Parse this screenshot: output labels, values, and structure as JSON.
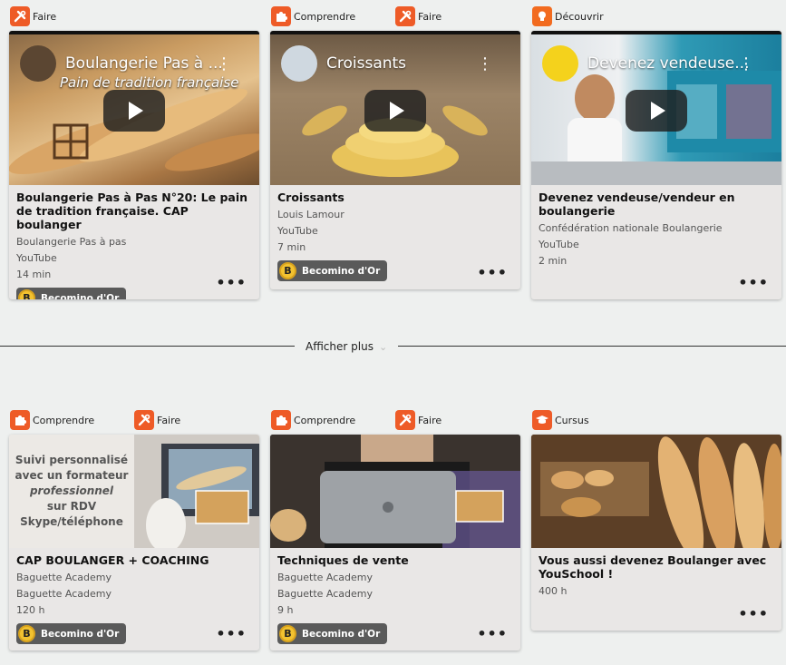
{
  "tag_labels": {
    "faire": "Faire",
    "comprendre": "Comprendre",
    "decouvrir": "Découvrir",
    "cursus": "Cursus"
  },
  "badge_label": "Becomino d'Or",
  "show_more": "Afficher plus",
  "cards": [
    {
      "overlay_title": "Boulangerie Pas à ...",
      "overlay_subtitle": "Pain de tradition française",
      "title": "Boulangerie Pas à Pas N°20: Le pain de tradition française. CAP boulanger",
      "meta": [
        "Boulangerie Pas à pas",
        "YouTube",
        "14 min"
      ]
    },
    {
      "overlay_title": "Croissants",
      "title": "Croissants",
      "meta": [
        "Louis Lamour",
        "YouTube",
        "7 min"
      ]
    },
    {
      "overlay_title": "Devenez vendeuse...",
      "title": "Devenez vendeuse/vendeur en boulangerie",
      "meta": [
        "Confédération nationale Boulangerie",
        "YouTube",
        "2 min"
      ]
    },
    {
      "thumb_text": [
        "Suivi personnalisé",
        "avec un formateur",
        "professionnel",
        "sur RDV",
        "Skype/téléphone"
      ],
      "title": "CAP BOULANGER + COACHING",
      "meta": [
        "Baguette Academy",
        "Baguette Academy",
        "120 h"
      ]
    },
    {
      "title": "Techniques de vente",
      "meta": [
        "Baguette Academy",
        "Baguette Academy",
        "9 h"
      ]
    },
    {
      "title": "Vous aussi devenez Boulanger avec YouSchool !",
      "meta": [
        "400 h"
      ]
    }
  ]
}
